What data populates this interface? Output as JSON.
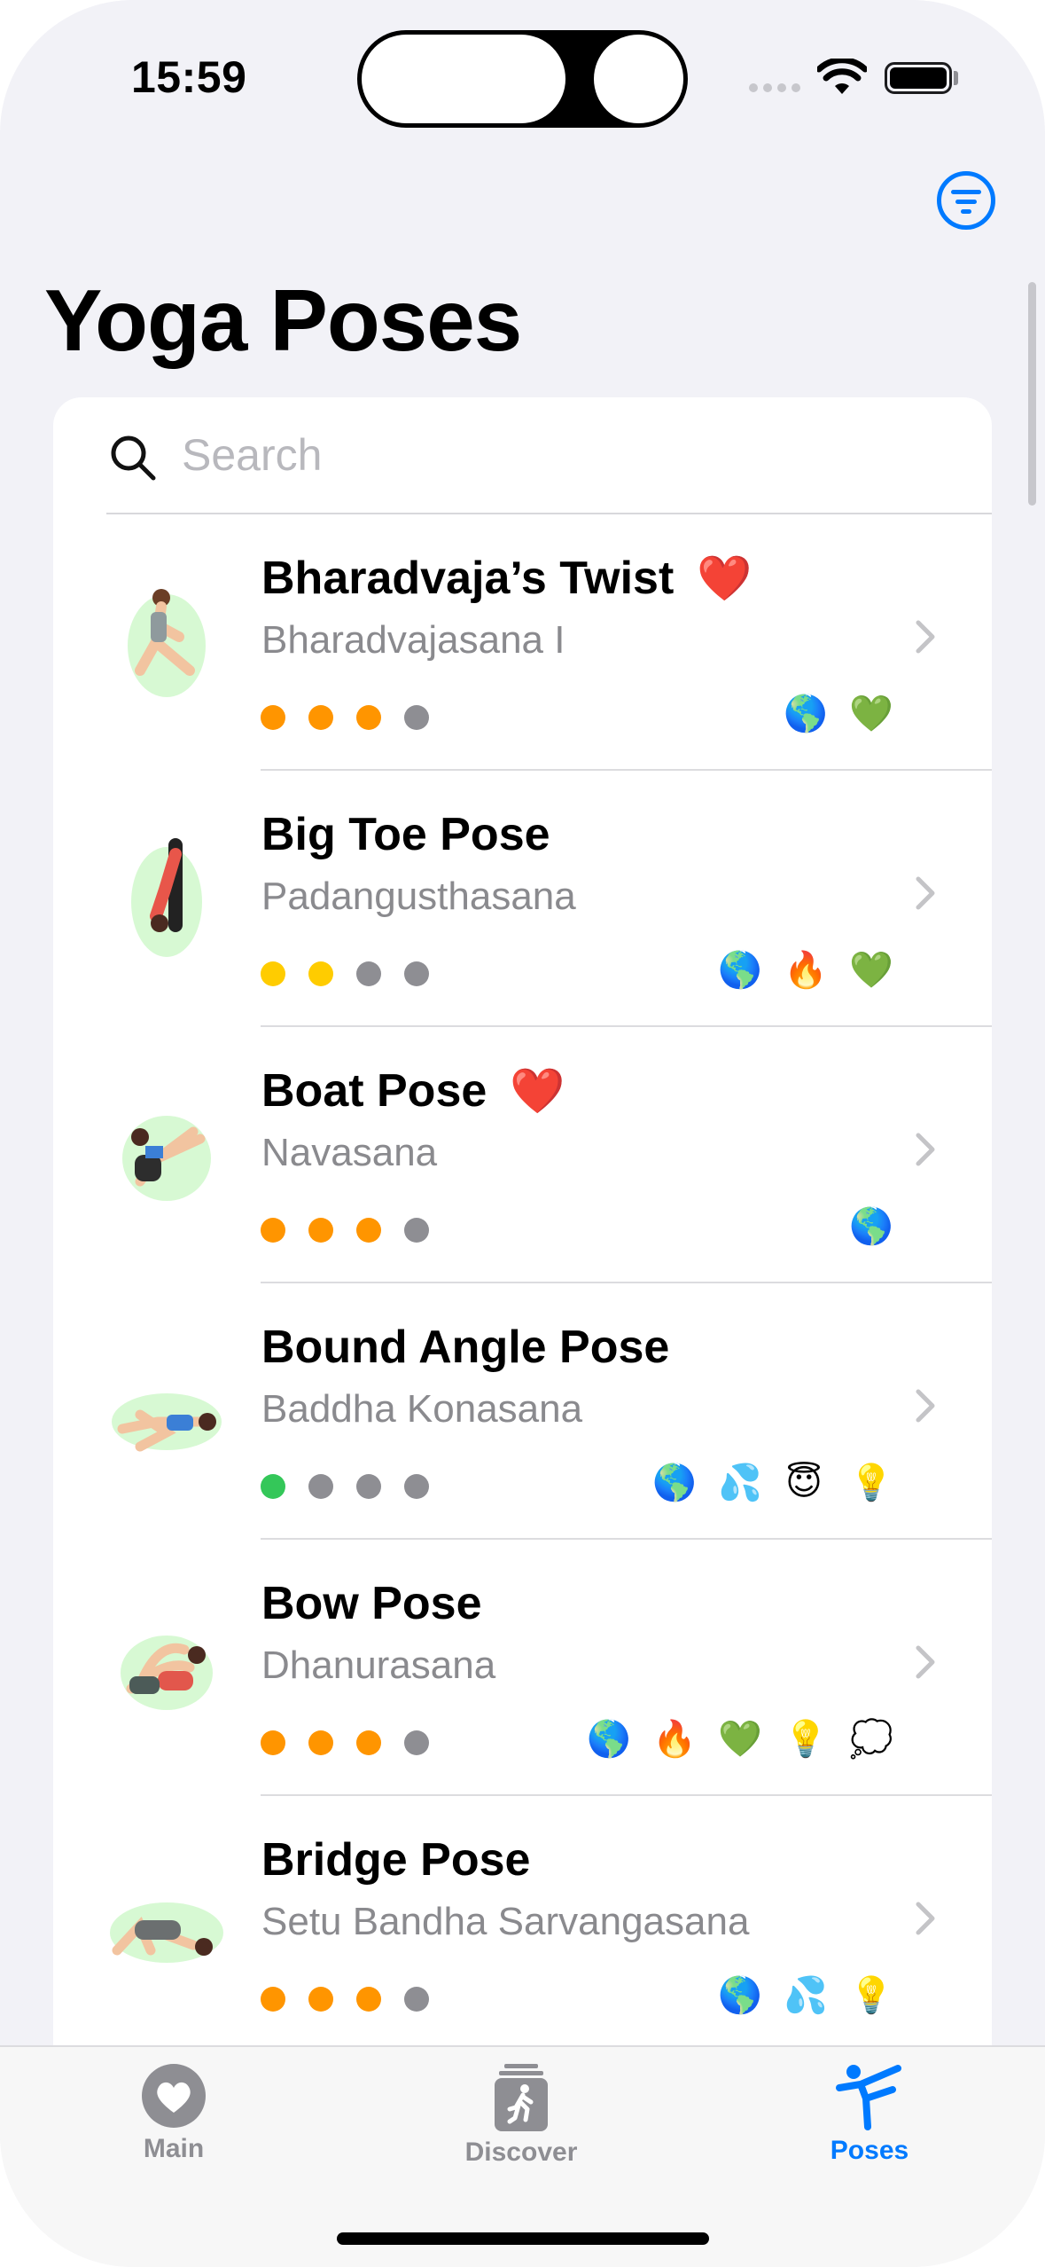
{
  "status_bar": {
    "time": "15:59"
  },
  "header": {
    "title": "Yoga Poses",
    "filter_icon": "filter-circle-icon"
  },
  "search": {
    "placeholder": "Search"
  },
  "colors": {
    "accent": "#007aff",
    "orange": "#ff9500",
    "yellow": "#ffcc00",
    "green": "#34c759",
    "gray": "#8e8e93",
    "heart": "#ff3b30"
  },
  "poses": [
    {
      "name": "Bharadvaja’s Twist",
      "sanskrit": "Bharadvajasana I",
      "favorite": "❤️",
      "level_dots": [
        "orange",
        "orange",
        "orange",
        "gray"
      ],
      "badges": [
        "🌎",
        "💚"
      ]
    },
    {
      "name": "Big Toe Pose",
      "sanskrit": "Padangusthasana",
      "favorite": "",
      "level_dots": [
        "yellow",
        "yellow",
        "gray",
        "gray"
      ],
      "badges": [
        "🌎",
        "🔥",
        "💚"
      ]
    },
    {
      "name": "Boat Pose",
      "sanskrit": "Navasana",
      "favorite": "❤️",
      "level_dots": [
        "orange",
        "orange",
        "orange",
        "gray"
      ],
      "badges": [
        "🌎"
      ]
    },
    {
      "name": "Bound Angle Pose",
      "sanskrit": "Baddha Konasana",
      "favorite": "",
      "level_dots": [
        "green",
        "gray",
        "gray",
        "gray"
      ],
      "badges": [
        "🌎",
        "💦",
        "😇",
        "💡"
      ]
    },
    {
      "name": "Bow Pose",
      "sanskrit": "Dhanurasana",
      "favorite": "",
      "level_dots": [
        "orange",
        "orange",
        "orange",
        "gray"
      ],
      "badges": [
        "🌎",
        "🔥",
        "💚",
        "💡",
        "💭"
      ]
    },
    {
      "name": "Bridge Pose",
      "sanskrit": "Setu Bandha Sarvangasana",
      "favorite": "",
      "level_dots": [
        "orange",
        "orange",
        "orange",
        "gray"
      ],
      "badges": [
        "🌎",
        "💦",
        "💡"
      ]
    }
  ],
  "tab_bar": {
    "items": [
      {
        "label": "Main",
        "icon": "heart-circle-icon",
        "active": false
      },
      {
        "label": "Discover",
        "icon": "figure-run-square-stack-icon",
        "active": false
      },
      {
        "label": "Poses",
        "icon": "figure-yoga-icon",
        "active": true
      }
    ]
  }
}
